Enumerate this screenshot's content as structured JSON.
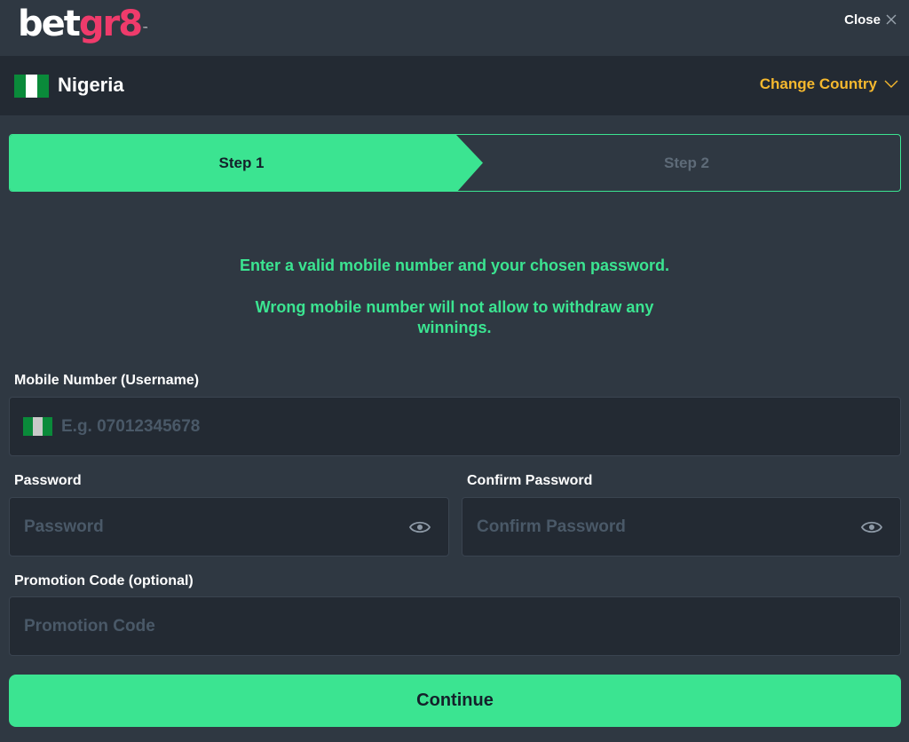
{
  "header": {
    "logo_bet": "bet",
    "logo_gr8": "gr8",
    "logo_tm": "™",
    "close_label": "Close"
  },
  "country": {
    "name": "Nigeria",
    "change_label": "Change Country"
  },
  "steps": [
    {
      "label": "Step 1",
      "active": true
    },
    {
      "label": "Step 2",
      "active": false
    }
  ],
  "info": {
    "line1": "Enter a valid mobile number and your chosen password.",
    "line2": "Wrong mobile number will not allow to withdraw any winnings."
  },
  "form": {
    "mobile": {
      "label": "Mobile Number (Username)",
      "placeholder": "E.g. 07012345678",
      "value": ""
    },
    "password": {
      "label": "Password",
      "placeholder": "Password",
      "value": ""
    },
    "confirm_password": {
      "label": "Confirm Password",
      "placeholder": "Confirm Password",
      "value": ""
    },
    "promo": {
      "label": "Promotion Code (optional)",
      "placeholder": "Promotion Code",
      "value": ""
    },
    "continue_label": "Continue"
  },
  "colors": {
    "accent": "#3be491",
    "brand_pink": "#ef3b6b",
    "change_country": "#f5b82e",
    "background": "#2f3842",
    "panel": "#232a33"
  },
  "icons": {
    "close": "close-icon",
    "chevron": "chevron-down-icon",
    "eye": "eye-icon",
    "flag": "nigeria-flag-icon"
  }
}
